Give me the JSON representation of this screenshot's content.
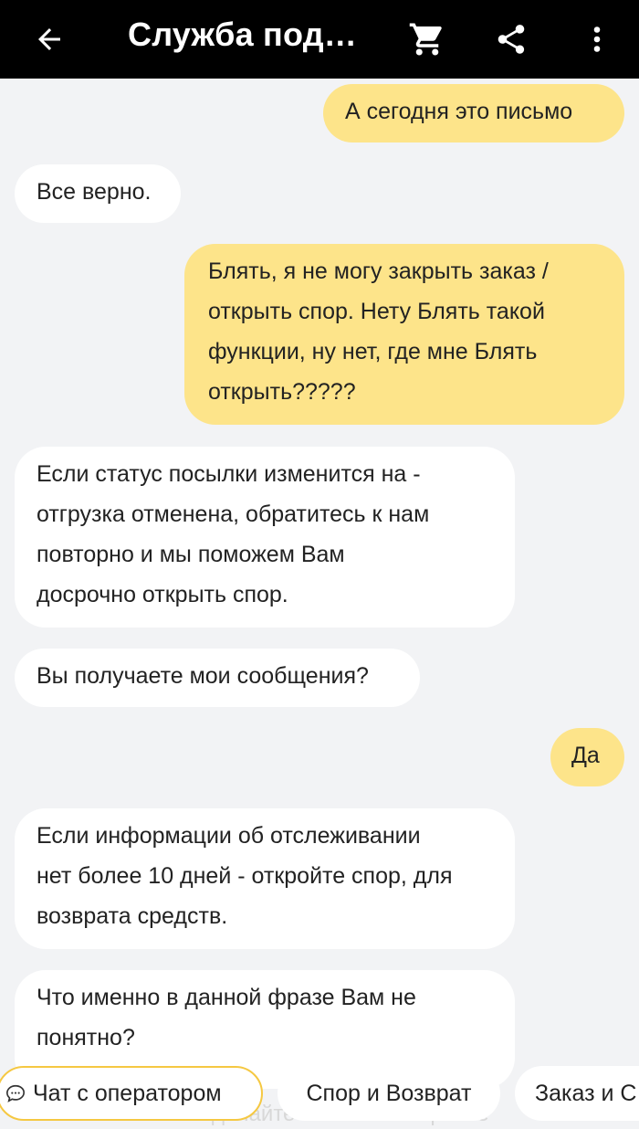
{
  "header": {
    "title": "Служба под…",
    "icons": [
      "back-arrow-icon",
      "cart-icon",
      "share-icon",
      "more-vert-icon"
    ]
  },
  "messages": [
    {
      "side": "out",
      "lines": [
        "А сегодня это письмо"
      ]
    },
    {
      "side": "in",
      "lines": [
        "Все верно."
      ]
    },
    {
      "side": "out",
      "lines": [
        "Блять, я не могу закрыть заказ /",
        "открыть спор. Нету Блять такой",
        "функции, ну нет, где мне Блять",
        "открыть?????"
      ]
    },
    {
      "side": "in",
      "lines": [
        "Если статус посылки изменится на -",
        "отгрузка отменена, обратитесь к нам",
        "повторно и мы поможем Вам",
        "досрочно открыть спор."
      ]
    },
    {
      "side": "in",
      "lines": [
        "Вы получаете мои сообщения?"
      ]
    },
    {
      "side": "out",
      "lines": [
        "Да"
      ]
    },
    {
      "side": "in",
      "lines": [
        "Если информации об отслеживании",
        "нет более 10 дней - откройте спор, для",
        "возврата средств."
      ]
    },
    {
      "side": "in",
      "lines": [
        "Что именно в данной фразе Вам не",
        "понятно?"
      ]
    }
  ],
  "quick_replies": {
    "operator": "Чат с оператором",
    "dispute": "Спор и Возврат",
    "order": "Заказ и С"
  },
  "input_hint": "сделайте это все и откройте",
  "colors": {
    "header_bg": "#000000",
    "outgoing_bubble": "#fde48a",
    "incoming_bubble": "#ffffff",
    "chat_bg": "#f2f3f5",
    "chip_accent": "#f5c842"
  }
}
